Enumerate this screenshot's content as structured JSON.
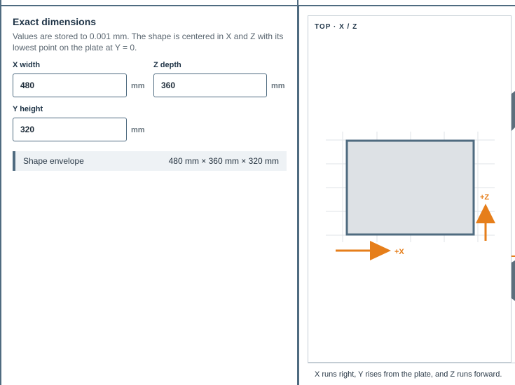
{
  "panel": {
    "title": "Exact dimensions",
    "description": "Values are stored to 0.001 mm. The shape is centered in X and Z with its lowest point on the plate at Y = 0."
  },
  "fields": {
    "x_width": {
      "label": "X width",
      "value": "480",
      "unit": "mm"
    },
    "z_depth": {
      "label": "Z depth",
      "value": "360",
      "unit": "mm"
    },
    "y_height": {
      "label": "Y height",
      "value": "320",
      "unit": "mm"
    }
  },
  "envelope": {
    "label": "Shape envelope",
    "value": "480 mm × 360 mm × 320 mm"
  },
  "preview": {
    "view_label": "TOP · X / Z",
    "x_axis_label": "+X",
    "z_axis_label": "+Z",
    "caption": "X runs right, Y rises from the plate, and Z runs forward.",
    "colors": {
      "shape_fill": "#dde1e5",
      "shape_stroke": "#4f6b80",
      "axis": "#e67e1a",
      "grid": "#dfe3e7"
    }
  }
}
